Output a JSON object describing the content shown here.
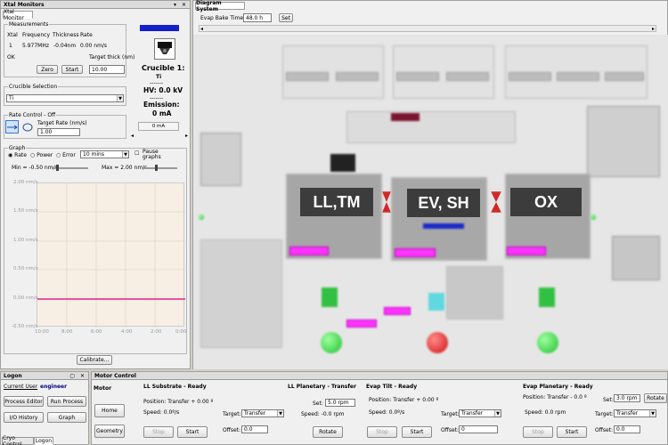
{
  "xtal": {
    "window_title": "Xtal Monitors",
    "tab_label": "Xtal Monitor",
    "measurements": {
      "group_label": "Measurements",
      "headers": [
        "Xtal",
        "Frequency",
        "Thickness",
        "Rate"
      ],
      "row": [
        "1",
        "5.977MHz",
        "-0.04nm",
        "0.00 nm/s"
      ],
      "status": "OK",
      "target_thick_label": "Target thick (nm)",
      "zero_label": "Zero",
      "start_label": "Start",
      "target_thick_value": "10.00"
    },
    "crucible": {
      "title": "Crucible 1:",
      "material": "Ti",
      "dashes1": "-------",
      "hv": "HV: 0.0 kV",
      "dashes2": "-------",
      "emission_label": "Emission:",
      "emission_value": "0 mA",
      "current_value": "0 mA"
    },
    "crucible_selection": {
      "group_label": "Crucible Selection",
      "value": "Ti"
    },
    "rate_control": {
      "group_label": "Rate Control - Off",
      "target_rate_label": "Target Rate (nm/s)",
      "target_rate_value": "1.00"
    },
    "graph": {
      "group_label": "Graph",
      "radio_rate": "Rate",
      "radio_power": "Power",
      "radio_error": "Error",
      "time_select": "10 mins",
      "pause_label": "Pause graphs",
      "min_label": "Min = -0.50 nm/s",
      "max_label": "Max = 2.00 nm/s",
      "y_ticks": [
        "2.00 nm/s",
        "1.50 nm/s",
        "1.00 nm/s",
        "0.50 nm/s",
        "0.00 nm/s",
        "-0.50 nm/s"
      ],
      "x_ticks": [
        "10:00",
        "8:00",
        "6:00",
        "4:00",
        "2:00",
        "0:00"
      ],
      "calibrate_label": "Calibrate..."
    }
  },
  "diagram": {
    "window_title": "Diagram System",
    "bake_timer_label": "Evap Bake Timer",
    "bake_timer_value": "48.0 h",
    "set_label": "Set",
    "labels": {
      "ll_tm": "LL,TM",
      "ev_sh": "EV, SH",
      "ox": "OX"
    },
    "colors": {
      "pink": "#ff33ff",
      "green": "#1ec02a",
      "red": "#d01010"
    }
  },
  "logon": {
    "window_title": "Logon",
    "current_user_label": "Current User",
    "current_user": "engineer",
    "buttons": [
      "Process Editor",
      "Run Process",
      "I/O History",
      "Graph"
    ],
    "tabs": [
      "Cryo Control",
      "Logon"
    ]
  },
  "motor": {
    "window_title": "Motor Control",
    "side_label": "Motor",
    "home_label": "Home",
    "geometry_label": "Geometry",
    "ll_substrate": {
      "title": "LL Substrate - Ready",
      "position": "Position: Transfer + 0.00 º",
      "speed": "Speed: 0.0º/s",
      "target_label": "Target:",
      "target_value": "Transfer",
      "offset_label": "Offset:",
      "offset_value": "0.0",
      "stop": "Stop",
      "start": "Start"
    },
    "ll_planetary": {
      "title": "LL Planetary - Transfer",
      "set_label": "Set:",
      "set_value": "5.0 rpm",
      "speed": "Speed: -0.0 rpm",
      "rotate": "Rotate"
    },
    "evap_tilt": {
      "title": "Evap Tilt - Ready",
      "position": "Position: Transfer + 0.00 º",
      "speed": "Speed: 0.0º/s",
      "target_label": "Target:",
      "target_value": "Transfer",
      "offset_label": "Offset:",
      "offset_value": "0",
      "stop": "Stop",
      "start": "Start"
    },
    "evap_planetary": {
      "title": "Evap Planetary - Ready",
      "position": "Position: Transfer - 0.0 º",
      "set_label": "Set:",
      "set_value": "3.0 rpm",
      "rotate": "Rotate",
      "speed": "Speed: 0.0 rpm",
      "target_label": "Target:",
      "target_value": "Transfer",
      "offset_label": "Offset:",
      "offset_value": "0.0",
      "stop": "Stop",
      "start": "Start"
    }
  }
}
